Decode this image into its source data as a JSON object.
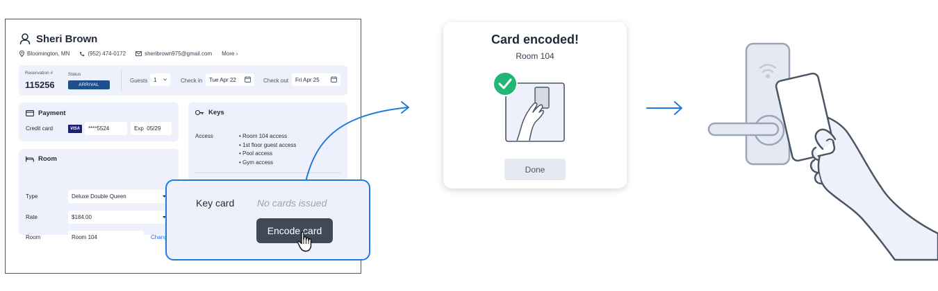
{
  "guest": {
    "name": "Sheri Brown",
    "location": "Bloomington, MN",
    "phone": "(952) 474-0172",
    "email": "sheribrown975@gmail.com",
    "more_label": "More ›"
  },
  "reservation": {
    "number_label": "Reservation #",
    "number": "115256",
    "status_label": "Status",
    "status": "ARRIVAL",
    "guests_label": "Guests",
    "guests_value": "1",
    "checkin_label": "Check in",
    "checkin_value": "Tue Apr 22",
    "checkout_label": "Check out",
    "checkout_value": "Fri Apr 25"
  },
  "payment": {
    "title": "Payment",
    "credit_card_label": "Credit card",
    "card_brand": "VISA",
    "card_number": "****5524",
    "exp_label": "Exp",
    "exp_value": "05/29"
  },
  "room": {
    "title": "Room",
    "type_label": "Type",
    "type_value": "Deluxe Double Queen",
    "rate_label": "Rate",
    "rate_value": "$184.00",
    "room_label": "Room",
    "room_value": "Room 104",
    "change_label": "Chang"
  },
  "keys": {
    "title": "Keys",
    "access_label": "Access",
    "access_items": [
      "Room 104 access",
      "1st floor guest access",
      "Pool access",
      "Gym access"
    ]
  },
  "keycard": {
    "label": "Key card",
    "status": "No cards issued",
    "encode_label": "Encode card"
  },
  "dialog": {
    "title": "Card encoded!",
    "subtitle": "Room 104",
    "done_label": "Done"
  },
  "colors": {
    "accent_blue": "#1f7ae0",
    "card_bg": "#eef1fb",
    "success_green": "#22b573",
    "dark_button": "#3f4a56",
    "status_badge": "#1f4e8c"
  }
}
